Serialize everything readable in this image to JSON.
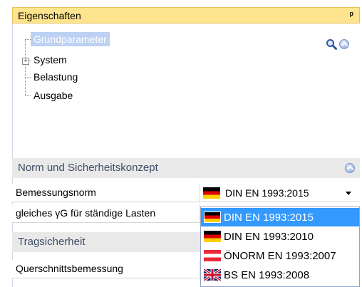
{
  "panel": {
    "title": "Eigenschaften",
    "pin_icon": "pin-icon"
  },
  "tree": {
    "items": [
      {
        "label": "Grundparameter",
        "selected": true
      },
      {
        "label": "System",
        "expandable": true
      },
      {
        "label": "Belastung"
      },
      {
        "label": "Ausgabe"
      }
    ]
  },
  "toolbar_icons": [
    "search-icon",
    "collapse-up-icon"
  ],
  "sections": {
    "norm": {
      "title": "Norm und Sicherheitskonzept",
      "rows": [
        {
          "label": "Bemessungsnorm",
          "value": "DIN EN 1993:2015"
        },
        {
          "label": "gleiches γG für ständige Lasten"
        }
      ]
    },
    "trag": {
      "title": "Tragsicherheit",
      "rows": [
        {
          "label": "Querschnittsbemessung"
        }
      ]
    }
  },
  "dropdown": {
    "selected": "DIN EN 1993:2015",
    "options": [
      {
        "label": "DIN EN 1993:2015",
        "flag": "germany-flag-icon",
        "selected": true
      },
      {
        "label": "DIN EN 1993:2010",
        "flag": "germany-flag-icon"
      },
      {
        "label": "ÖNORM EN 1993:2007",
        "flag": "austria-flag-icon"
      },
      {
        "label": "BS EN 1993:2008",
        "flag": "uk-flag-icon"
      }
    ]
  },
  "colors": {
    "title_bar": "#ffe48f",
    "section_bg": "#e9e9e9",
    "section_text": "#3f4c66",
    "tree_selection": "#bcd1f3",
    "dropdown_selection": "#3399ff"
  }
}
